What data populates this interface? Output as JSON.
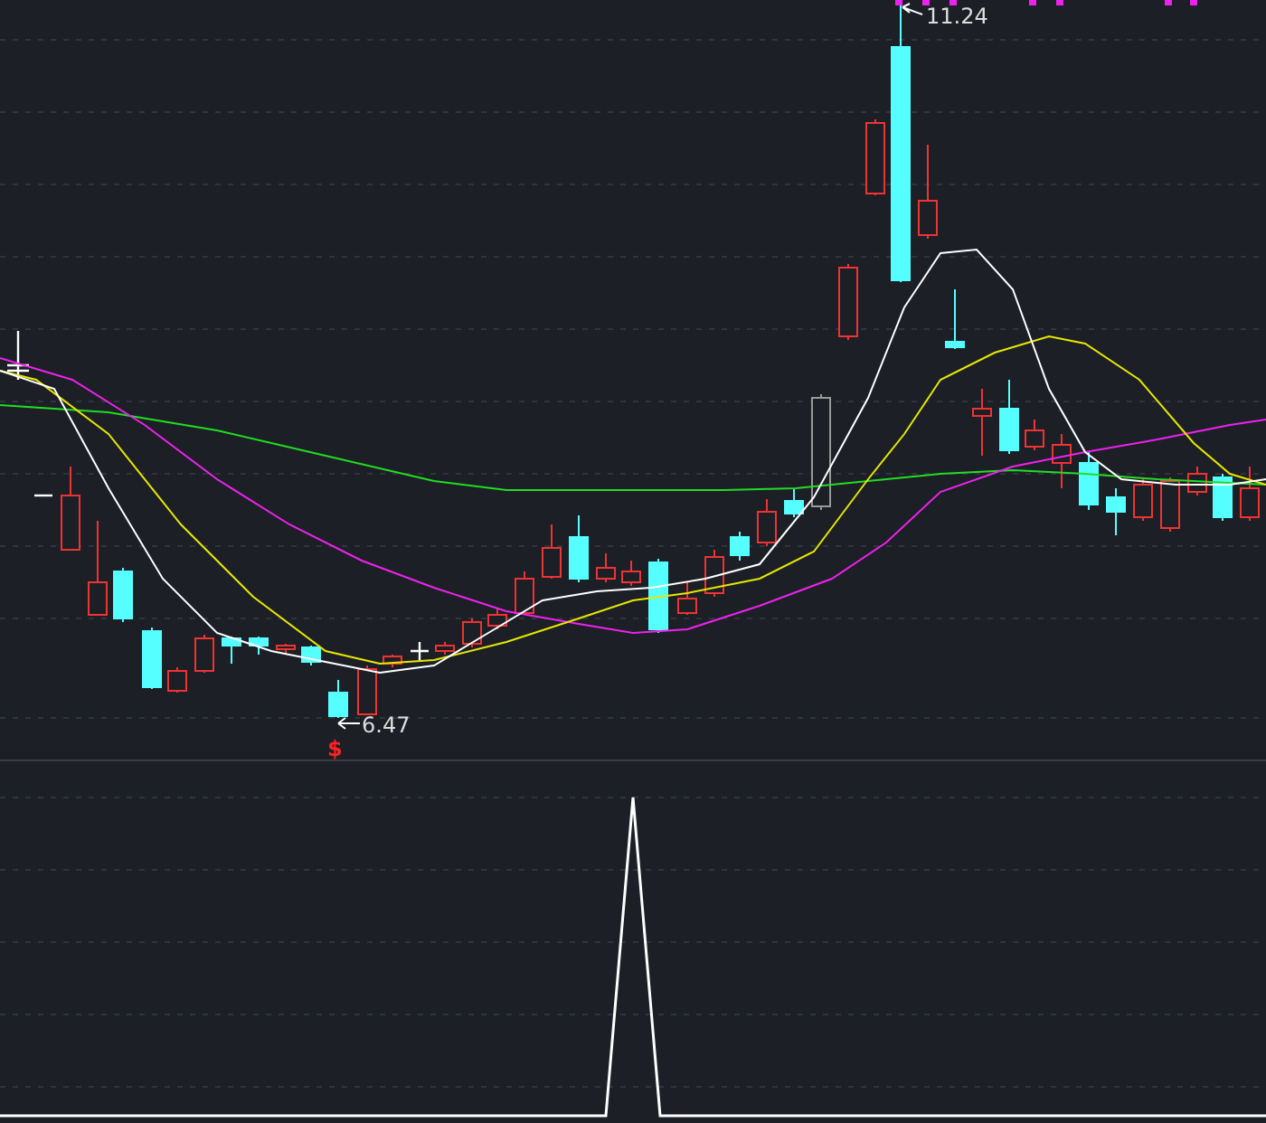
{
  "price_chart": {
    "high_label": "11.24",
    "low_label": "6.47",
    "signal_label": "$"
  }
}
